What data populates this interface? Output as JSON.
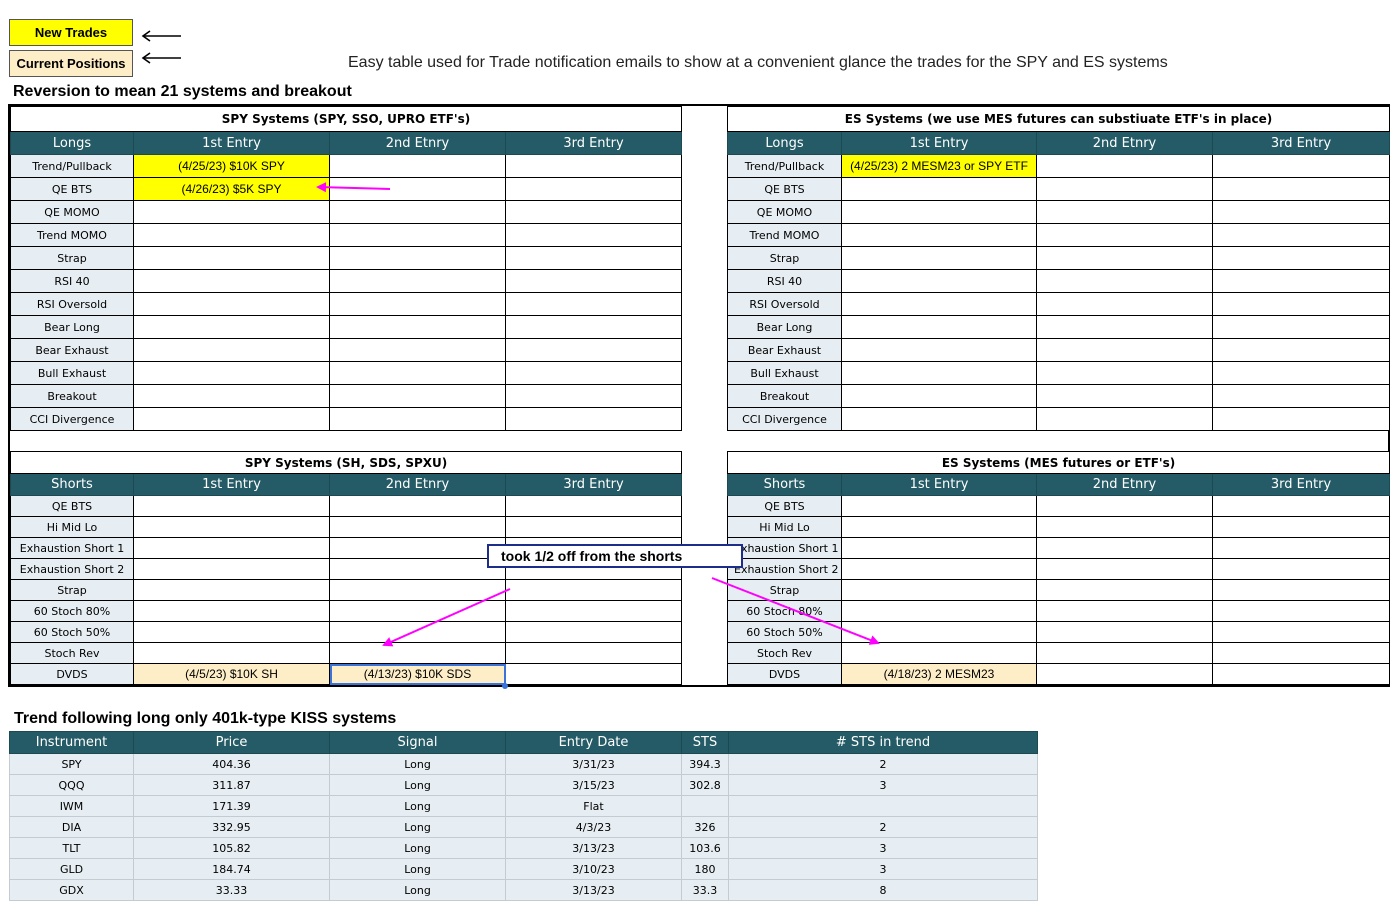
{
  "legend": {
    "new_trades": "New Trades",
    "current_positions": "Current Positions"
  },
  "colors": {
    "header_teal": "#245b66",
    "new_trade": "#ffff00",
    "current_position": "#fdeec8",
    "label_bg": "#e6eef3",
    "annotation_arrow": "#ff00ff",
    "note_border": "#1f2d8a"
  },
  "caption": "Easy table used for Trade notification emails to show at a convenient glance the trades for the SPY and ES systems",
  "reversion": {
    "title": "Reversion to mean 21 systems and breakout",
    "spy_long": {
      "title": "SPY Systems (SPY, SSO, UPRO ETF's)",
      "headers": [
        "Longs",
        "1st Entry",
        "2nd Etnry",
        "3rd Entry"
      ],
      "rows": [
        {
          "label": "Trend/Pullback",
          "e1": "(4/25/23)  $10K SPY",
          "e2": "",
          "e3": ""
        },
        {
          "label": "QE BTS",
          "e1": "(4/26/23)  $5K SPY",
          "e2": "",
          "e3": ""
        },
        {
          "label": "QE MOMO",
          "e1": "",
          "e2": "",
          "e3": ""
        },
        {
          "label": "Trend MOMO",
          "e1": "",
          "e2": "",
          "e3": ""
        },
        {
          "label": "Strap",
          "e1": "",
          "e2": "",
          "e3": ""
        },
        {
          "label": "RSI 40",
          "e1": "",
          "e2": "",
          "e3": ""
        },
        {
          "label": "RSI Oversold",
          "e1": "",
          "e2": "",
          "e3": ""
        },
        {
          "label": "Bear Long",
          "e1": "",
          "e2": "",
          "e3": ""
        },
        {
          "label": "Bear Exhaust",
          "e1": "",
          "e2": "",
          "e3": ""
        },
        {
          "label": "Bull Exhaust",
          "e1": "",
          "e2": "",
          "e3": ""
        },
        {
          "label": "Breakout",
          "e1": "",
          "e2": "",
          "e3": ""
        },
        {
          "label": "CCI Divergence",
          "e1": "",
          "e2": "",
          "e3": ""
        }
      ]
    },
    "es_long": {
      "title": "ES Systems (we use MES futures can substiuate ETF's in place)",
      "headers": [
        "Longs",
        "1st Entry",
        "2nd Etnry",
        "3rd Entry"
      ],
      "rows": [
        {
          "label": "Trend/Pullback",
          "e1": "(4/25/23)  2 MESM23 or SPY ETF",
          "e2": "",
          "e3": ""
        },
        {
          "label": "QE BTS",
          "e1": "",
          "e2": "",
          "e3": ""
        },
        {
          "label": "QE MOMO",
          "e1": "",
          "e2": "",
          "e3": ""
        },
        {
          "label": "Trend MOMO",
          "e1": "",
          "e2": "",
          "e3": ""
        },
        {
          "label": "Strap",
          "e1": "",
          "e2": "",
          "e3": ""
        },
        {
          "label": "RSI 40",
          "e1": "",
          "e2": "",
          "e3": ""
        },
        {
          "label": "RSI Oversold",
          "e1": "",
          "e2": "",
          "e3": ""
        },
        {
          "label": "Bear Long",
          "e1": "",
          "e2": "",
          "e3": ""
        },
        {
          "label": "Bear Exhaust",
          "e1": "",
          "e2": "",
          "e3": ""
        },
        {
          "label": "Bull Exhaust",
          "e1": "",
          "e2": "",
          "e3": ""
        },
        {
          "label": "Breakout",
          "e1": "",
          "e2": "",
          "e3": ""
        },
        {
          "label": "CCI Divergence",
          "e1": "",
          "e2": "",
          "e3": ""
        }
      ]
    },
    "spy_short": {
      "title": "SPY Systems (SH, SDS, SPXU)",
      "headers": [
        "Shorts",
        "1st Entry",
        "2nd Etnry",
        "3rd Entry"
      ],
      "rows": [
        {
          "label": "QE BTS",
          "e1": "",
          "e2": "",
          "e3": ""
        },
        {
          "label": "Hi Mid Lo",
          "e1": "",
          "e2": "",
          "e3": ""
        },
        {
          "label": "Exhaustion Short 1",
          "e1": "",
          "e2": "",
          "e3": ""
        },
        {
          "label": "Exhaustion Short 2",
          "e1": "",
          "e2": "",
          "e3": ""
        },
        {
          "label": "Strap",
          "e1": "",
          "e2": "",
          "e3": ""
        },
        {
          "label": "60 Stoch 80%",
          "e1": "",
          "e2": "",
          "e3": ""
        },
        {
          "label": "60 Stoch 50%",
          "e1": "",
          "e2": "",
          "e3": ""
        },
        {
          "label": "Stoch Rev",
          "e1": "",
          "e2": "",
          "e3": ""
        },
        {
          "label": "DVDS",
          "e1": "(4/5/23)  $10K SH",
          "e2": "(4/13/23)  $10K SDS",
          "e3": ""
        }
      ]
    },
    "es_short": {
      "title": "ES Systems (MES futures or ETF's)",
      "headers": [
        "Shorts",
        "1st Entry",
        "2nd Etnry",
        "3rd Entry"
      ],
      "rows": [
        {
          "label": "QE BTS",
          "e1": "",
          "e2": "",
          "e3": ""
        },
        {
          "label": "Hi Mid Lo",
          "e1": "",
          "e2": "",
          "e3": ""
        },
        {
          "label": "Exhaustion Short 1",
          "e1": "",
          "e2": "",
          "e3": ""
        },
        {
          "label": "Exhaustion Short 2",
          "e1": "",
          "e2": "",
          "e3": ""
        },
        {
          "label": "Strap",
          "e1": "",
          "e2": "",
          "e3": ""
        },
        {
          "label": "60 Stoch 80%",
          "e1": "",
          "e2": "",
          "e3": ""
        },
        {
          "label": "60 Stoch 50%",
          "e1": "",
          "e2": "",
          "e3": ""
        },
        {
          "label": "Stoch Rev",
          "e1": "",
          "e2": "",
          "e3": ""
        },
        {
          "label": "DVDS",
          "e1": "(4/18/23)  2 MESM23",
          "e2": "",
          "e3": ""
        }
      ]
    },
    "annotation_note": "took 1/2 off from the shorts"
  },
  "trend": {
    "title": "Trend following long only 401k-type KISS systems",
    "headers": [
      "Instrument",
      "Price",
      "Signal",
      "Entry Date",
      "STS",
      "# STS in trend"
    ],
    "rows": [
      [
        "SPY",
        "404.36",
        "Long",
        "3/31/23",
        "394.3",
        "2"
      ],
      [
        "QQQ",
        "311.87",
        "Long",
        "3/15/23",
        "302.8",
        "3"
      ],
      [
        "IWM",
        "171.39",
        "Long",
        "Flat",
        "",
        ""
      ],
      [
        "DIA",
        "332.95",
        "Long",
        "4/3/23",
        "326",
        "2"
      ],
      [
        "TLT",
        "105.82",
        "Long",
        "3/13/23",
        "103.6",
        "3"
      ],
      [
        "GLD",
        "184.74",
        "Long",
        "3/10/23",
        "180",
        "3"
      ],
      [
        "GDX",
        "33.33",
        "Long",
        "3/13/23",
        "33.3",
        "8"
      ]
    ]
  }
}
